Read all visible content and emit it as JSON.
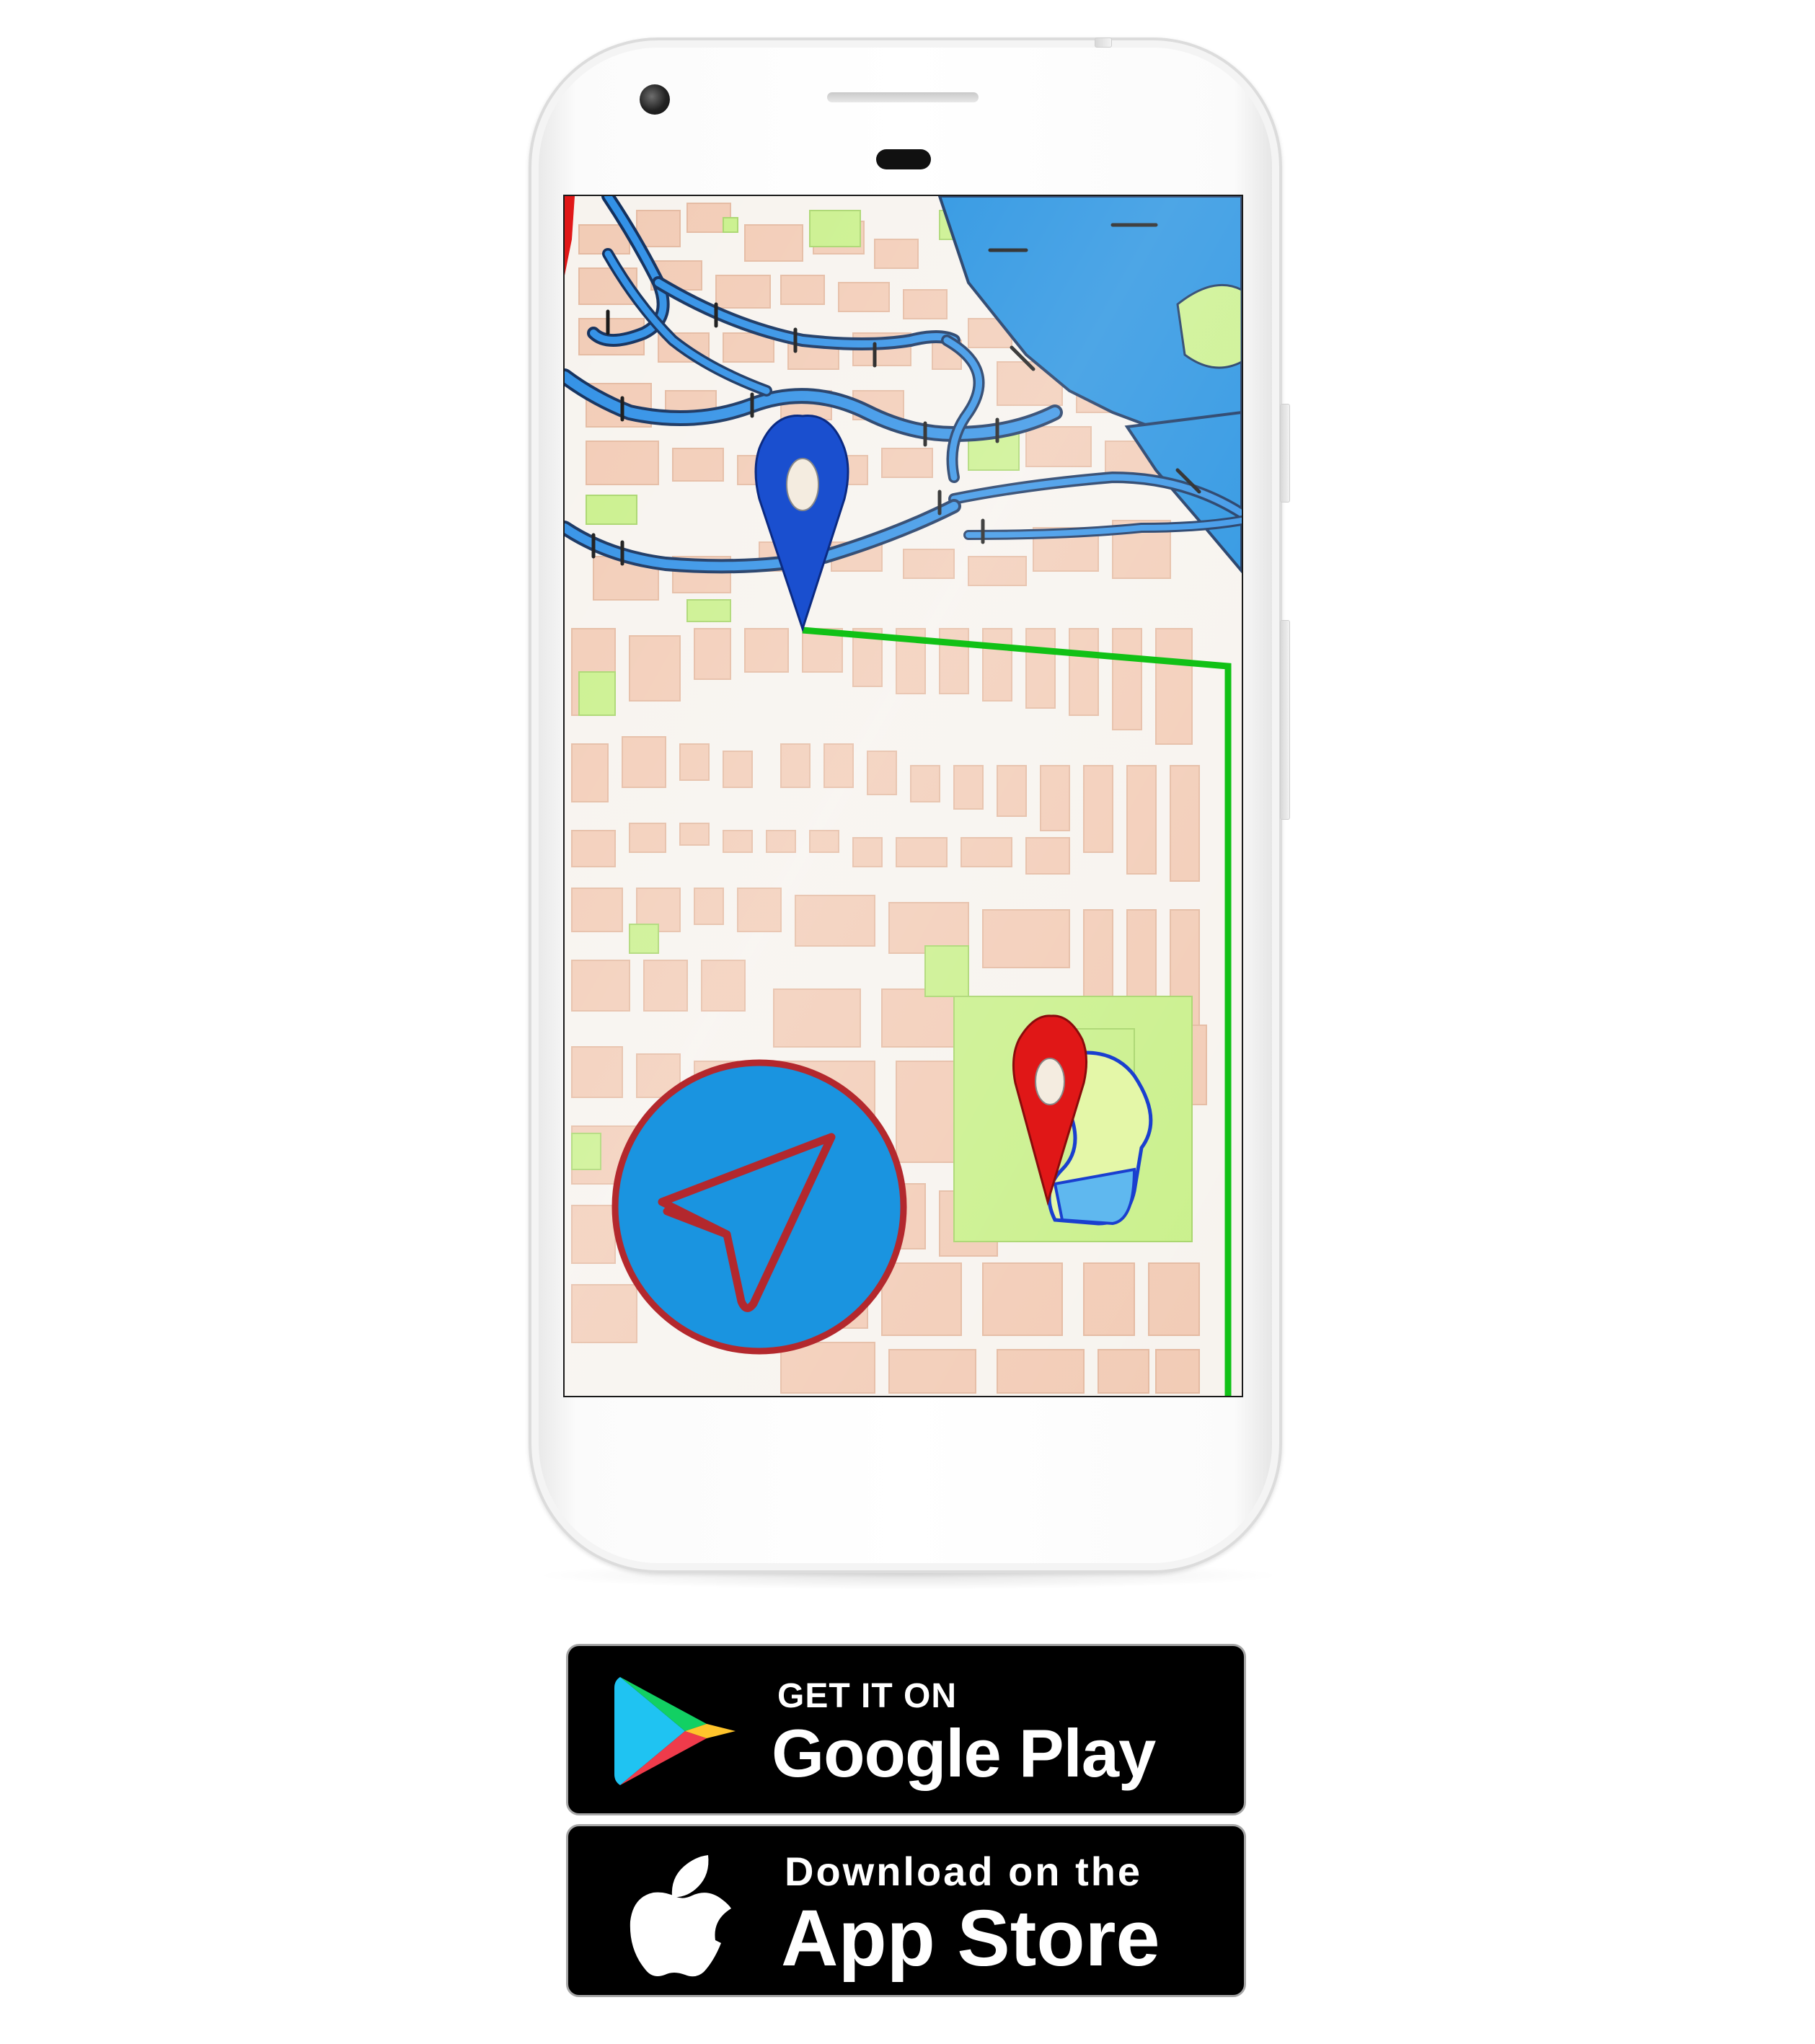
{
  "screen": {
    "map": {
      "route_color": "#11c116",
      "water_color": "#1e8ee0",
      "park_color": "#c9f08a",
      "block_color": "#f2cbb5",
      "road_color": "#f7f3ee",
      "start_pin_color": "#1a4fcf",
      "end_pin_color": "#e01717"
    },
    "fab": {
      "icon": "navigation-arrow-icon",
      "fill_color": "#1a94e0",
      "ring_color": "#b3282d"
    }
  },
  "badges": {
    "google_play": {
      "small_text": "GET IT ON",
      "big_text": "Google Play",
      "icon": "google-play-icon"
    },
    "app_store": {
      "small_text": "Download on the",
      "big_text": "App Store",
      "icon": "apple-icon"
    }
  }
}
